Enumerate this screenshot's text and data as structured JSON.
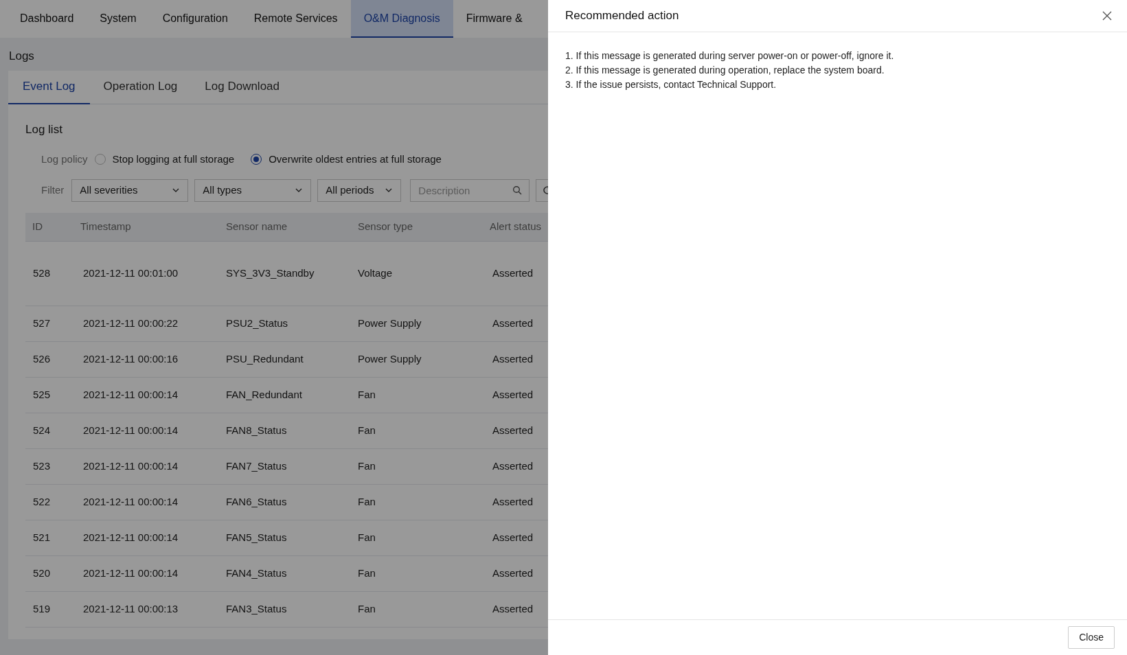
{
  "nav_tabs": [
    {
      "label": "Dashboard",
      "selected": false
    },
    {
      "label": "System",
      "selected": false
    },
    {
      "label": "Configuration",
      "selected": false
    },
    {
      "label": "Remote Services",
      "selected": false
    },
    {
      "label": "O&M Diagnosis",
      "selected": true
    },
    {
      "label": "Firmware &",
      "selected": false
    }
  ],
  "page_title": "Logs",
  "sub_tabs": [
    {
      "label": "Event Log",
      "selected": true
    },
    {
      "label": "Operation Log",
      "selected": false
    },
    {
      "label": "Log Download",
      "selected": false
    }
  ],
  "section_title": "Log list",
  "log_policy": {
    "label": "Log policy",
    "options": [
      {
        "label": "Stop logging at full storage",
        "selected": false
      },
      {
        "label": "Overwrite oldest entries at full storage",
        "selected": true
      }
    ]
  },
  "filter": {
    "label": "Filter",
    "dropdowns": [
      "All severities",
      "All types",
      "All periods"
    ],
    "search": {
      "placeholder": "Description"
    }
  },
  "table": {
    "columns": [
      "ID",
      "Timestamp",
      "Sensor name",
      "Sensor type",
      "Alert status"
    ],
    "rows": [
      [
        "528",
        "2021-12-11 00:01:00",
        "SYS_3V3_Standby",
        "Voltage",
        "Asserted"
      ],
      [
        "527",
        "2021-12-11 00:00:22",
        "PSU2_Status",
        "Power Supply",
        "Asserted"
      ],
      [
        "526",
        "2021-12-11 00:00:16",
        "PSU_Redundant",
        "Power Supply",
        "Asserted"
      ],
      [
        "525",
        "2021-12-11 00:00:14",
        "FAN_Redundant",
        "Fan",
        "Asserted"
      ],
      [
        "524",
        "2021-12-11 00:00:14",
        "FAN8_Status",
        "Fan",
        "Asserted"
      ],
      [
        "523",
        "2021-12-11 00:00:14",
        "FAN7_Status",
        "Fan",
        "Asserted"
      ],
      [
        "522",
        "2021-12-11 00:00:14",
        "FAN6_Status",
        "Fan",
        "Asserted"
      ],
      [
        "521",
        "2021-12-11 00:00:14",
        "FAN5_Status",
        "Fan",
        "Asserted"
      ],
      [
        "520",
        "2021-12-11 00:00:14",
        "FAN4_Status",
        "Fan",
        "Asserted"
      ],
      [
        "519",
        "2021-12-11 00:00:13",
        "FAN3_Status",
        "Fan",
        "Asserted"
      ]
    ]
  },
  "drawer": {
    "title": "Recommended action",
    "steps": [
      "1. If this message is generated during server power-on or power-off, ignore it.",
      "2. If this message is generated during operation, replace the system board.",
      "3. If the issue persists, contact Technical Support."
    ],
    "close_button": "Close"
  }
}
